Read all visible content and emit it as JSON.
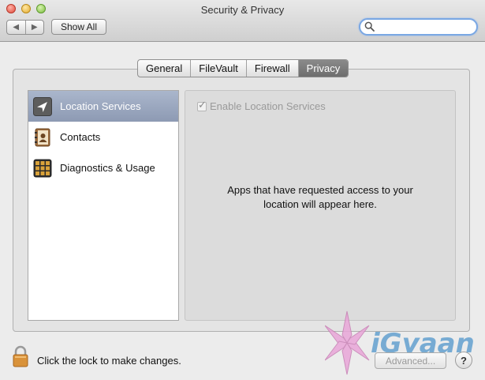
{
  "window": {
    "title": "Security & Privacy"
  },
  "toolbar": {
    "back_icon": "chevron-left-icon",
    "forward_icon": "chevron-right-icon",
    "show_all_label": "Show All",
    "search": {
      "value": "",
      "placeholder": "",
      "icon": "search-icon"
    }
  },
  "tabs": [
    {
      "label": "General",
      "active": false
    },
    {
      "label": "FileVault",
      "active": false
    },
    {
      "label": "Firewall",
      "active": false
    },
    {
      "label": "Privacy",
      "active": true
    }
  ],
  "sidebar": {
    "items": [
      {
        "label": "Location Services",
        "icon": "location-arrow-icon",
        "selected": true
      },
      {
        "label": "Contacts",
        "icon": "contacts-book-icon",
        "selected": false
      },
      {
        "label": "Diagnostics & Usage",
        "icon": "diagnostics-grid-icon",
        "selected": false
      }
    ]
  },
  "content": {
    "enable_label": "Enable Location Services",
    "enable_checked": true,
    "info_line1": "Apps that have requested access to your",
    "info_line2": "location will appear here."
  },
  "footer": {
    "lock_icon": "lock-icon",
    "lock_text": "Click the lock to make changes.",
    "advanced_label": "Advanced...",
    "help_label": "?"
  },
  "watermark": {
    "text": "iGyaan"
  },
  "colors": {
    "selection": "#8d9ab3",
    "active_tab": "#7a7a7a",
    "search_focus": "#7aa7e3",
    "watermark": "#d98fc6"
  }
}
